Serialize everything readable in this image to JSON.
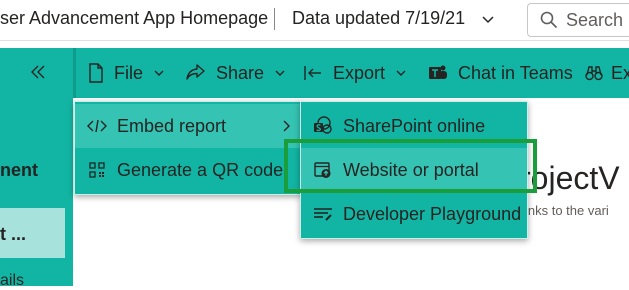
{
  "header": {
    "app_title": "ser Advancement App Homepage",
    "data_updated": "Data updated 7/19/21",
    "search_placeholder": "Search"
  },
  "leftnav": {
    "heading": "nent",
    "selected_item": "t ...",
    "item2": "ails"
  },
  "toolbar": {
    "file": "File",
    "share": "Share",
    "export": "Export",
    "chat": "Chat in Teams",
    "more": "Ex"
  },
  "file_menu": {
    "items": [
      {
        "label": "Embed report",
        "icon": "code-icon"
      },
      {
        "label": "Generate a QR code",
        "icon": "qr-code-icon"
      }
    ]
  },
  "embed_menu": {
    "items": [
      {
        "label": "SharePoint online",
        "icon": "sharepoint-icon"
      },
      {
        "label": "Website or portal",
        "icon": "website-icon"
      },
      {
        "label": "Developer Playground",
        "icon": "developer-playground-icon"
      }
    ]
  },
  "report": {
    "title": "rojectV",
    "subtitle": "s links to the vari"
  },
  "colors": {
    "accent": "#12b5a3",
    "menu_hover": "#35c4b3",
    "selected_nav": "#a7e3dc",
    "highlight": "#1a9e3c"
  }
}
